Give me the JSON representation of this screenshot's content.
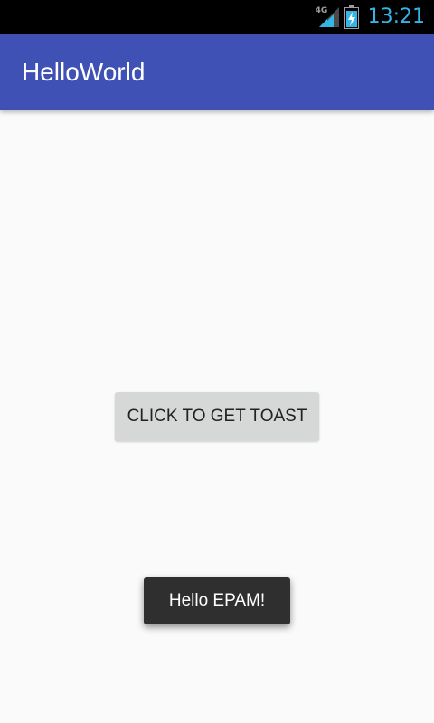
{
  "status_bar": {
    "network_type": "4G",
    "time": "13:21",
    "icons": [
      "signal-icon",
      "battery-charging-icon"
    ],
    "time_color": "#33b5e5"
  },
  "app_bar": {
    "title": "HelloWorld",
    "color": "#3f51b5"
  },
  "main": {
    "button_label": "CLICK TO GET TOAST"
  },
  "toast": {
    "message": "Hello EPAM!"
  }
}
